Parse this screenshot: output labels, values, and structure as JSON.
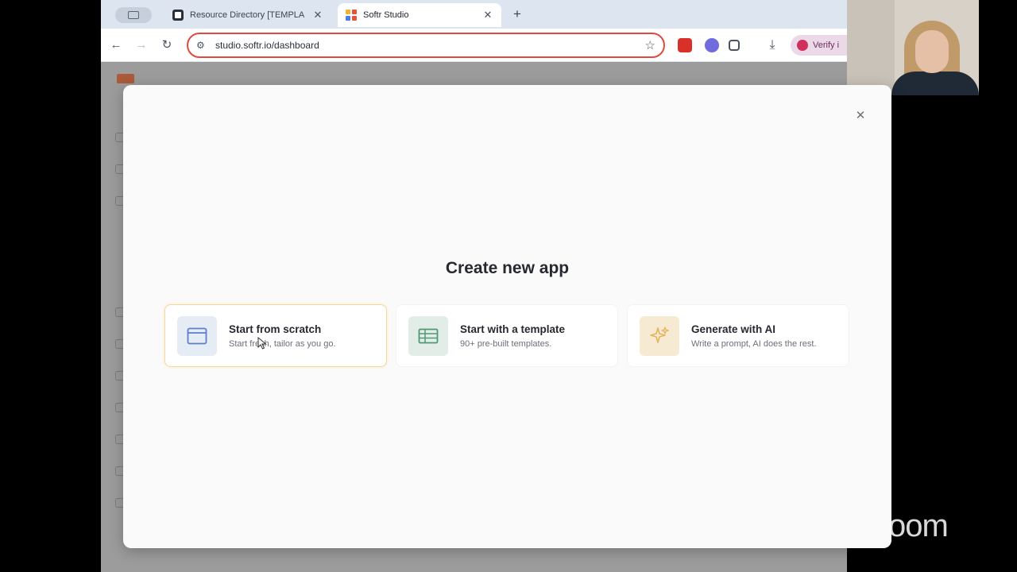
{
  "browser": {
    "tabs": [
      {
        "title": "Resource Directory [TEMPLA",
        "active": false,
        "favicon": "notion-icon"
      },
      {
        "title": "Softr Studio",
        "active": true,
        "favicon": "softr-icon"
      }
    ],
    "url": "studio.softr.io/dashboard",
    "profile_label": "Verify i"
  },
  "modal": {
    "title": "Create new app",
    "options": [
      {
        "title": "Start from scratch",
        "subtitle": "Start fresh, tailor as you go.",
        "icon": "window-icon",
        "selected": true
      },
      {
        "title": "Start with a template",
        "subtitle": "90+ pre-built templates.",
        "icon": "table-icon",
        "selected": false
      },
      {
        "title": "Generate with AI",
        "subtitle": "Write a prompt, AI does the rest.",
        "icon": "sparkle-icon",
        "selected": false
      }
    ]
  },
  "overlay": {
    "watermark": "oom"
  },
  "colors": {
    "omnibox_border": "#e1483f",
    "selected_card_border": "#f0d8a6",
    "scratch_icon": "#5b7fc7",
    "template_icon": "#4f9a74",
    "ai_icon": "#e5b35c"
  }
}
